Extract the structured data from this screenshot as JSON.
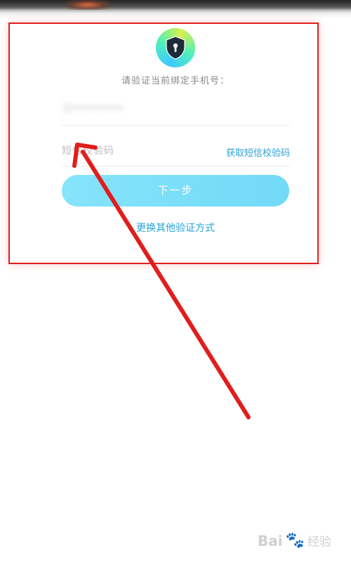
{
  "verify": {
    "prompt": "请验证当前绑定手机号：",
    "phone_masked": "1••••••••",
    "code_placeholder": "短信校验码",
    "get_code_label": "获取短信校验码",
    "next_button_label": "下一步",
    "switch_method_label": "更换其他验证方式"
  },
  "icons": {
    "badge": "shield-lock-icon"
  },
  "colors": {
    "link": "#2aa3d8",
    "button": "#7bdff9",
    "annotation": "#e11d1d"
  },
  "watermark": {
    "brand": "Bai",
    "sub": "经验"
  }
}
